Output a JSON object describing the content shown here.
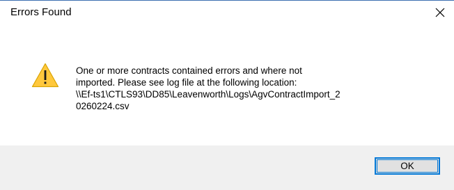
{
  "window": {
    "title": "Errors Found",
    "close_icon": "close-icon"
  },
  "message": {
    "icon": "warning-icon",
    "text": "One or more contracts contained errors and where not\nimported. Please see log file at the following location:\n\\\\Ef-ts1\\CTLS93\\DD85\\Leavenworth\\Logs\\AgvContractImport_2\n0260224.csv"
  },
  "buttons": {
    "ok_label": "OK"
  },
  "colors": {
    "accent": "#0078d7",
    "warning_fill": "#ffc83d",
    "footer_bg": "#f0f0f0"
  }
}
